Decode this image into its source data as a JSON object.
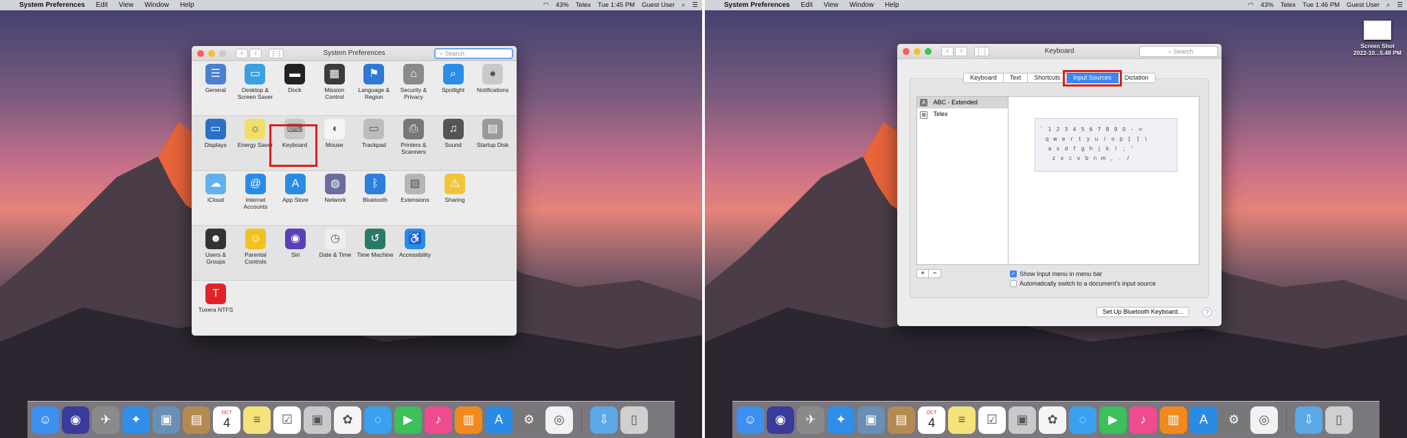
{
  "left": {
    "menubar": {
      "app": "System Preferences",
      "menus": [
        "Edit",
        "View",
        "Window",
        "Help"
      ],
      "battery": "43%",
      "input_source": "Telex",
      "clock": "Tue 1:45 PM",
      "user": "Guest User"
    },
    "window": {
      "title": "System Preferences",
      "search_placeholder": "Search",
      "rows": [
        [
          {
            "label": "General",
            "icon": "general-icon",
            "color": "#4a7fd4"
          },
          {
            "label": "Desktop & Screen Saver",
            "icon": "desktop-icon",
            "color": "#3aa0e0"
          },
          {
            "label": "Dock",
            "icon": "dock-icon",
            "color": "#222222"
          },
          {
            "label": "Mission Control",
            "icon": "mission-control-icon",
            "color": "#3b3b3b"
          },
          {
            "label": "Language & Region",
            "icon": "language-icon",
            "color": "#2f78d6"
          },
          {
            "label": "Security & Privacy",
            "icon": "security-icon",
            "color": "#8a8a8a"
          },
          {
            "label": "Spotlight",
            "icon": "spotlight-icon",
            "color": "#2b8de8"
          },
          {
            "label": "Notifications",
            "icon": "notifications-icon",
            "color": "#c9c9c9"
          }
        ],
        [
          {
            "label": "Displays",
            "icon": "displays-icon",
            "color": "#2a6fc9"
          },
          {
            "label": "Energy Saver",
            "icon": "energy-saver-icon",
            "color": "#f0de6a"
          },
          {
            "label": "Keyboard",
            "icon": "keyboard-icon",
            "color": "#c8c8c8"
          },
          {
            "label": "Mouse",
            "icon": "mouse-icon",
            "color": "#f4f4f4"
          },
          {
            "label": "Trackpad",
            "icon": "trackpad-icon",
            "color": "#bdbdbd"
          },
          {
            "label": "Printers & Scanners",
            "icon": "printer-icon",
            "color": "#777777"
          },
          {
            "label": "Sound",
            "icon": "sound-icon",
            "color": "#555555"
          },
          {
            "label": "Startup Disk",
            "icon": "startup-disk-icon",
            "color": "#9a9a9a"
          }
        ],
        [
          {
            "label": "iCloud",
            "icon": "icloud-icon",
            "color": "#5fb2ee"
          },
          {
            "label": "Internet Accounts",
            "icon": "internet-accounts-icon",
            "color": "#2a8be6"
          },
          {
            "label": "App Store",
            "icon": "app-store-icon",
            "color": "#2a8be6"
          },
          {
            "label": "Network",
            "icon": "network-icon",
            "color": "#6b6d9c"
          },
          {
            "label": "Bluetooth",
            "icon": "bluetooth-icon",
            "color": "#2a7fe0"
          },
          {
            "label": "Extensions",
            "icon": "extensions-icon",
            "color": "#b5b5b5"
          },
          {
            "label": "Sharing",
            "icon": "sharing-icon",
            "color": "#f0c53a"
          }
        ],
        [
          {
            "label": "Users & Groups",
            "icon": "users-icon",
            "color": "#333333"
          },
          {
            "label": "Parental Controls",
            "icon": "parental-controls-icon",
            "color": "#f2c31d"
          },
          {
            "label": "Siri",
            "icon": "siri-icon",
            "color": "#5a3fb8"
          },
          {
            "label": "Date & Time",
            "icon": "date-time-icon",
            "color": "#eeeeee"
          },
          {
            "label": "Time Machine",
            "icon": "time-machine-icon",
            "color": "#2a7a6a"
          },
          {
            "label": "Accessibility",
            "icon": "accessibility-icon",
            "color": "#2a8be6"
          }
        ],
        [
          {
            "label": "Tuxera NTFS",
            "icon": "tuxera-icon",
            "color": "#e0232a"
          }
        ]
      ]
    }
  },
  "right": {
    "menubar": {
      "app": "System Preferences",
      "menus": [
        "Edit",
        "View",
        "Window",
        "Help"
      ],
      "battery": "43%",
      "input_source": "Telex",
      "clock": "Tue 1:46 PM",
      "user": "Guest User"
    },
    "desktop_file": {
      "name": "Screen Shot",
      "date": "2022-10...5.48 PM"
    },
    "window": {
      "title": "Keyboard",
      "search_placeholder": "Search",
      "tabs": [
        "Keyboard",
        "Text",
        "Shortcuts",
        "Input Sources",
        "Dictation"
      ],
      "selected_tab": "Input Sources",
      "sources": [
        "ABC - Extended",
        "Telex"
      ],
      "keyboard_rows": [
        [
          "`",
          "1",
          "2",
          "3",
          "4",
          "5",
          "6",
          "7",
          "8",
          "9",
          "0",
          "-",
          "="
        ],
        [
          "q",
          "w",
          "e",
          "r",
          "t",
          "y",
          "u",
          "i",
          "o",
          "p",
          "[",
          "]",
          "\\"
        ],
        [
          "a",
          "s",
          "d",
          "f",
          "g",
          "h",
          "j",
          "k",
          "l",
          ";",
          "'"
        ],
        [
          "z",
          "x",
          "c",
          "v",
          "b",
          "n",
          "m",
          ",",
          ".",
          "/"
        ]
      ],
      "add_label": "+",
      "remove_label": "−",
      "show_input_menu": "Show Input menu in menu bar",
      "auto_switch": "Automatically switch to a document's input source",
      "bluetooth_button": "Set Up Bluetooth Keyboard...",
      "help_label": "?"
    }
  },
  "dock_items": [
    {
      "name": "finder-icon",
      "color": "#3d8ff0"
    },
    {
      "name": "siri-icon",
      "color": "#3a3a9a"
    },
    {
      "name": "launchpad-icon",
      "color": "#8a8a8a"
    },
    {
      "name": "safari-icon",
      "color": "#2f8ee8"
    },
    {
      "name": "preview-icon",
      "color": "#6a8fb5"
    },
    {
      "name": "contacts-icon",
      "color": "#b58a52"
    },
    {
      "name": "calendar-icon",
      "color": "#ffffff"
    },
    {
      "name": "notes-icon",
      "color": "#f6e27a"
    },
    {
      "name": "reminders-icon",
      "color": "#ffffff"
    },
    {
      "name": "photo-booth-icon",
      "color": "#c9c9c9"
    },
    {
      "name": "photos-icon",
      "color": "#f5f5f5"
    },
    {
      "name": "messages-icon",
      "color": "#3aa0f0"
    },
    {
      "name": "facetime-icon",
      "color": "#3cc05a"
    },
    {
      "name": "itunes-icon",
      "color": "#f04b8e"
    },
    {
      "name": "ibooks-icon",
      "color": "#f08a1e"
    },
    {
      "name": "app-store-icon",
      "color": "#2a8be6"
    },
    {
      "name": "system-preferences-icon",
      "color": "#777777"
    },
    {
      "name": "chrome-icon",
      "color": "#f2f2f2"
    },
    {
      "name": "downloads-icon",
      "color": "#5aa8e8"
    },
    {
      "name": "trash-icon",
      "color": "#d0d0d0"
    }
  ],
  "calendar_day": "4",
  "calendar_month": "OCT"
}
